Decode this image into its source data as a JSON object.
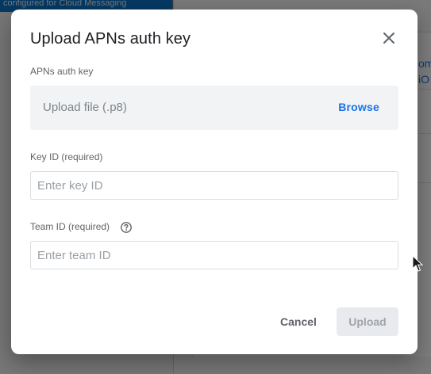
{
  "background": {
    "banner_text": "configured for Cloud Messaging",
    "side_text_1": "omm",
    "side_text_2": "iO"
  },
  "dialog": {
    "title": "Upload APNs auth key",
    "close_icon": "close-icon",
    "auth_key": {
      "label": "APNs auth key",
      "placeholder": "Upload file (.p8)",
      "browse_label": "Browse"
    },
    "key_id": {
      "label": "Key ID (required)",
      "placeholder": "Enter key ID",
      "value": ""
    },
    "team_id": {
      "label": "Team ID (required)",
      "help_icon": "help-circle-icon",
      "placeholder": "Enter team ID",
      "value": ""
    },
    "actions": {
      "cancel_label": "Cancel",
      "upload_label": "Upload",
      "upload_disabled": true
    }
  },
  "colors": {
    "accent": "#1a73e8",
    "banner": "#0b74c8",
    "disabled_bg": "#e8eaed"
  }
}
